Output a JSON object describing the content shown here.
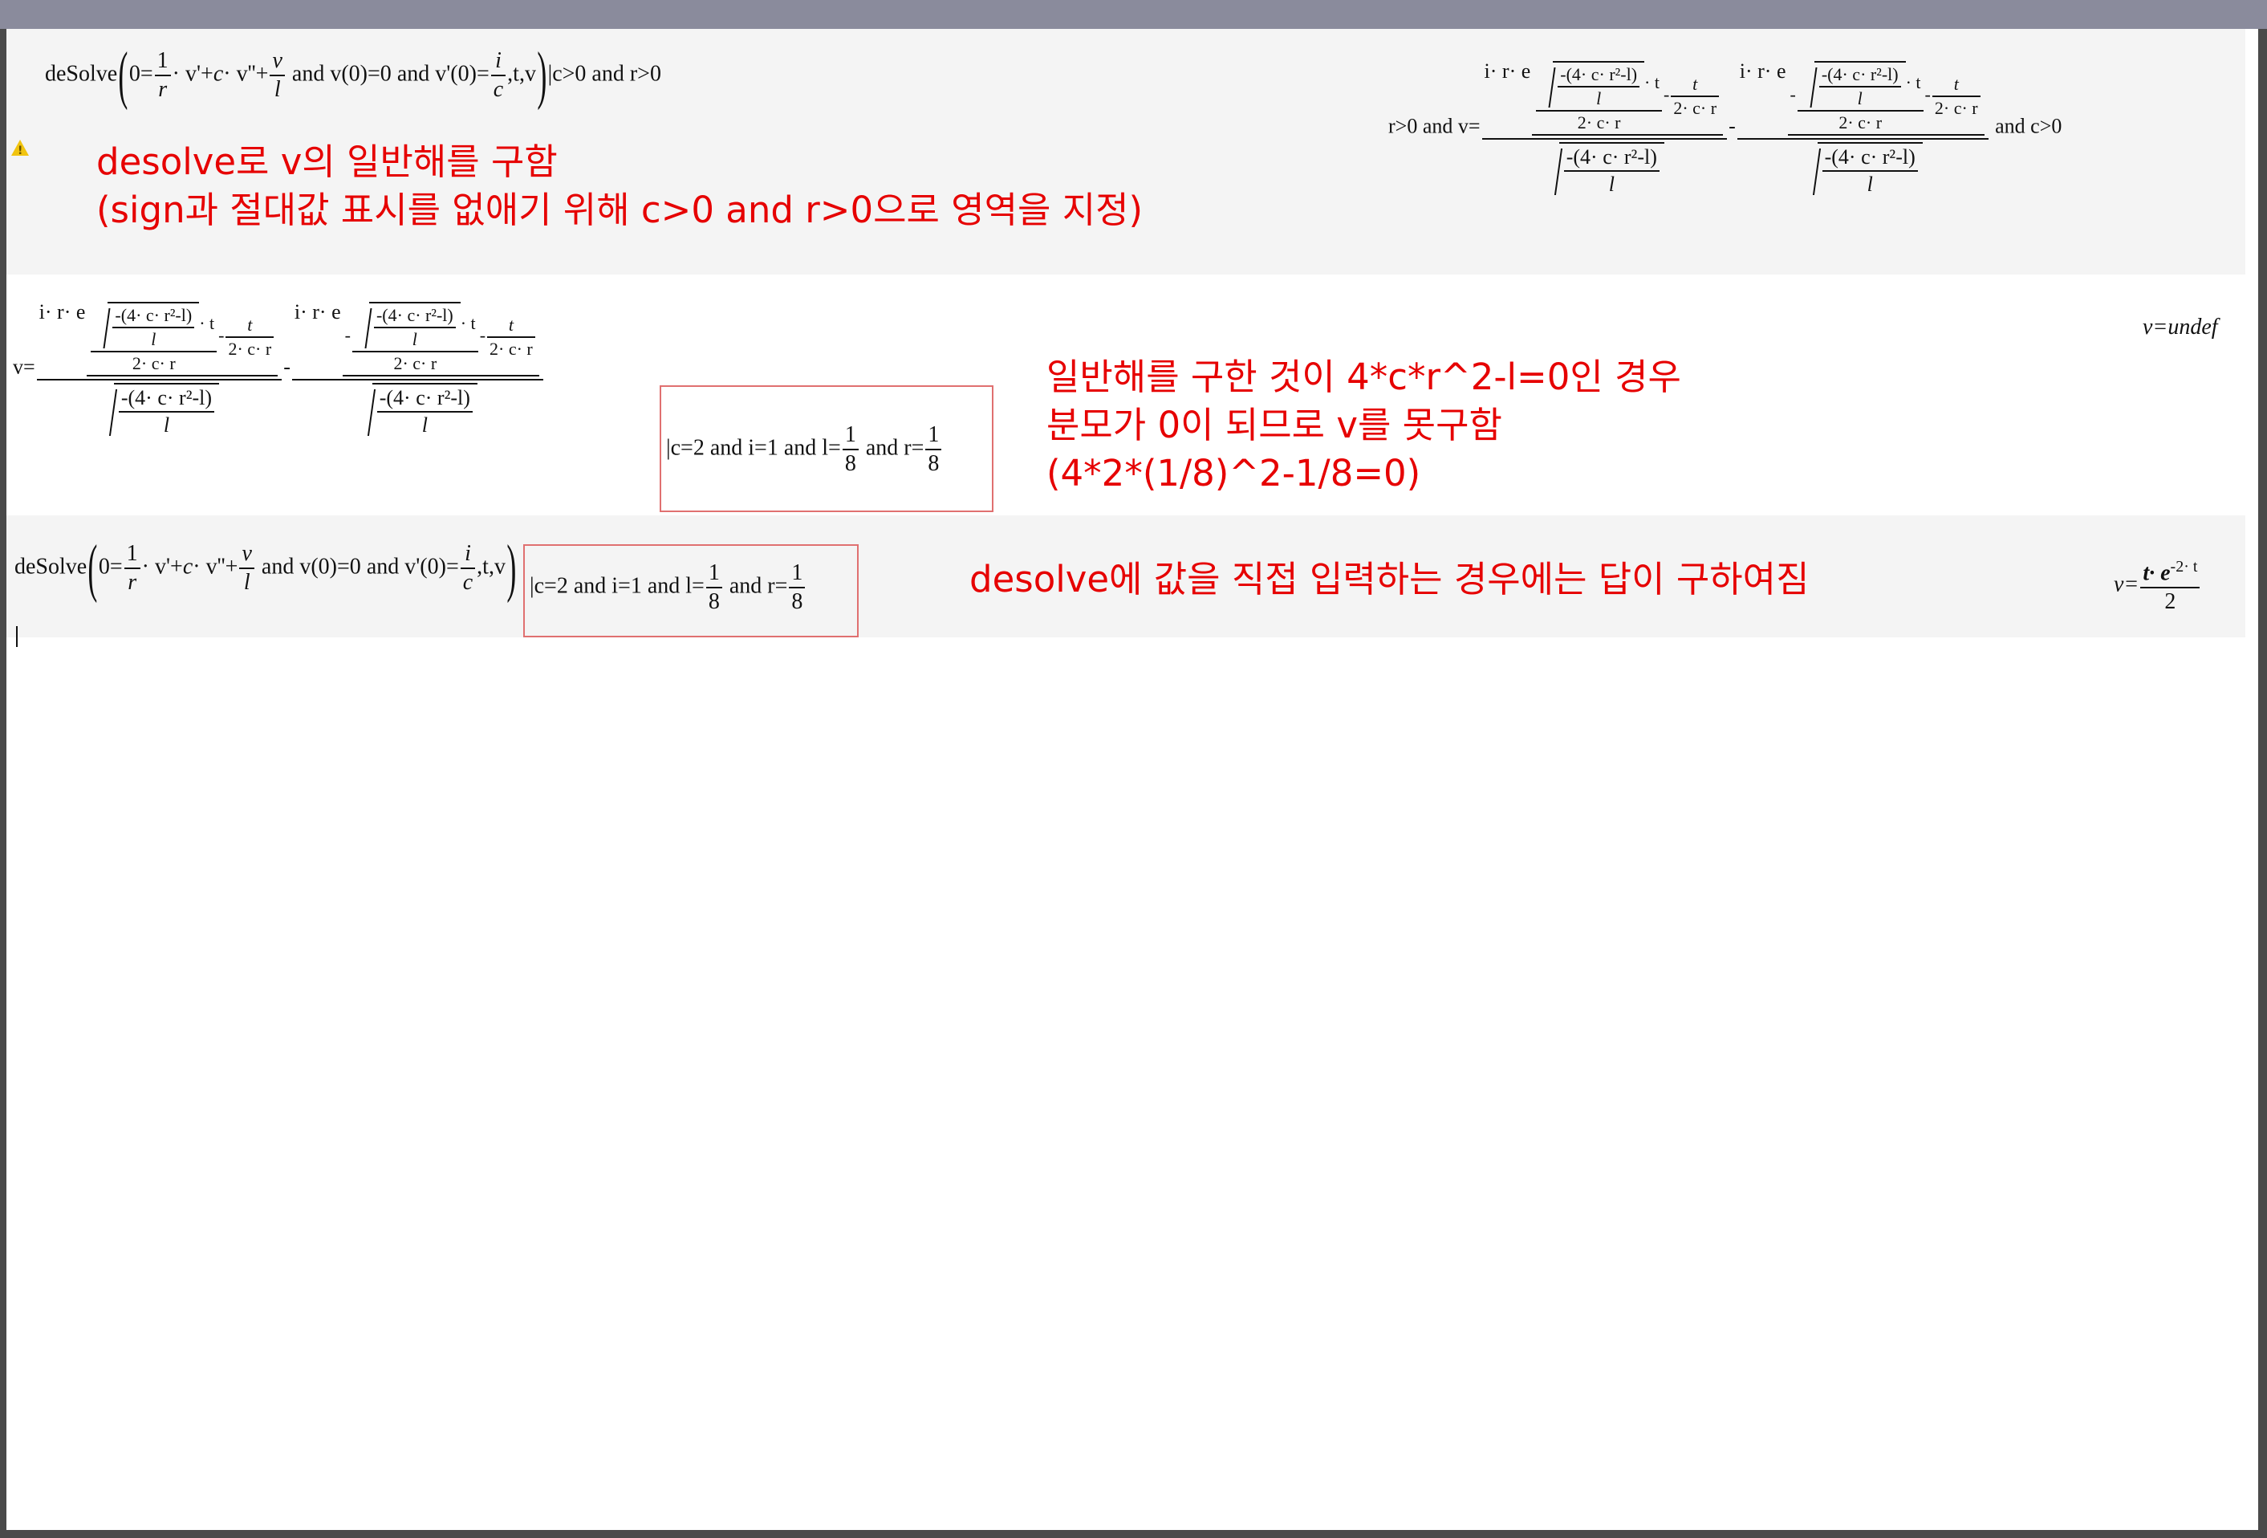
{
  "rows": [
    {
      "input": {
        "fn": "deSolve",
        "eq_lhs": "0=",
        "frac1_num": "1",
        "frac1_den": "r",
        "term1": "· v'+",
        "c": "c",
        "term2": "· v''+",
        "frac2_num": "v",
        "frac2_den": "l",
        "cond1": "and",
        "v0": "v(0)=0",
        "cond2": "and",
        "vp0_lhs": "v'(0)=",
        "frac3_num": "i",
        "frac3_den": "c",
        "vars": ",t,v",
        "constraint": "c>0 and r>0"
      },
      "output": {
        "prefix": "r>0 and v=",
        "radicand": "-(4· c· r²-l)",
        "radicand_den": "l",
        "coef": "i· r· e",
        "exp_tail": "· t",
        "minus": "-",
        "t_over": "t",
        "den_2cr": "2· c· r",
        "suffix": "and c>0"
      },
      "note_lines": [
        "desolve로 v의 일반해를 구함",
        "(sign과 절대값 표시를 없애기 위해 c>0 and r>0으로 영역을 지정)"
      ]
    },
    {
      "input": {
        "lhs": "v=",
        "constraint": "c=2 and i=1 and l=",
        "l_num": "1",
        "l_den": "8",
        "and_r": "and r=",
        "r_num": "1",
        "r_den": "8"
      },
      "output": "v=undef",
      "note_lines": [
        "일반해를 구한 것이 4*c*r^2-l=0인 경우",
        "분모가 0이 되므로 v를 못구함",
        "(4*2*(1/8)^2-1/8=0)"
      ]
    },
    {
      "input": {
        "constraint": "c=2 and i=1 and l=",
        "and_r": "and r="
      },
      "output": {
        "lhs": "v=",
        "num": "t· e",
        "exp": "-2· t",
        "den": "2"
      },
      "note_lines": [
        "desolve에 값을 직접 입력하는 경우에는 답이 구하여짐"
      ]
    }
  ],
  "colors": {
    "note": "#e60000",
    "box": "#e07070",
    "row_bg": "#f4f4f4",
    "frame": "#8a8b9c"
  },
  "icons": {
    "warning": "warning-icon"
  }
}
